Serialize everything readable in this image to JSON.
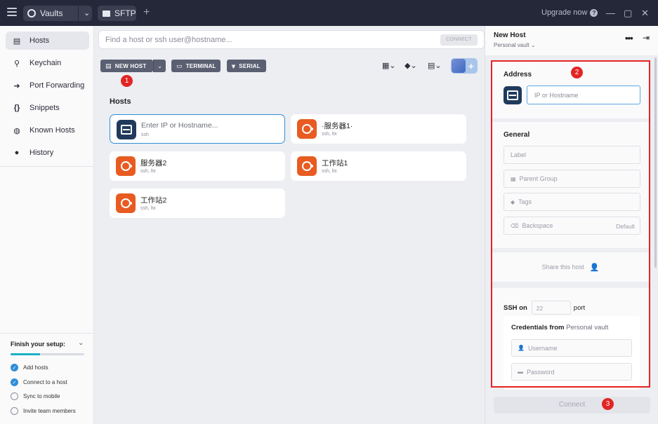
{
  "titlebar": {
    "vault_label": "Vaults",
    "sftp_label": "SFTP",
    "upgrade_label": "Upgrade now"
  },
  "sidebar": {
    "items": [
      {
        "label": "Hosts",
        "icon": "hosts-icon"
      },
      {
        "label": "Keychain",
        "icon": "key-icon"
      },
      {
        "label": "Port Forwarding",
        "icon": "forward-icon"
      },
      {
        "label": "Snippets",
        "icon": "braces-icon"
      },
      {
        "label": "Known Hosts",
        "icon": "known-hosts-icon"
      },
      {
        "label": "History",
        "icon": "history-icon"
      }
    ],
    "setup": {
      "title": "Finish your setup:",
      "progress": 0.4,
      "items": [
        {
          "label": "Add hosts",
          "done": true
        },
        {
          "label": "Connect to a host",
          "done": true
        },
        {
          "label": "Sync to mobile",
          "done": false
        },
        {
          "label": "Invite team members",
          "done": false
        }
      ]
    }
  },
  "main": {
    "search_placeholder": "Find a host or ssh user@hostname...",
    "connect_label": "CONNECT",
    "toolbar": {
      "new_host": "NEW HOST",
      "terminal": "TERMINAL",
      "serial": "SERIAL"
    },
    "hosts_heading": "Hosts",
    "hosts": [
      {
        "name": "Enter IP or Hostname...",
        "sub": "ssh",
        "type": "server"
      },
      {
        "name": "·服务器1·",
        "sub": "ssh, ltx",
        "type": "ubuntu"
      },
      {
        "name": "服务器2",
        "sub": "ssh, ltx",
        "type": "ubuntu"
      },
      {
        "name": "工作站1",
        "sub": "ssh, ltx",
        "type": "ubuntu"
      },
      {
        "name": "工作站2",
        "sub": "ssh, ltx",
        "type": "ubuntu"
      }
    ]
  },
  "panel": {
    "title": "New Host",
    "vault": "Personal vault",
    "address": {
      "title": "Address",
      "placeholder": "IP or Hostname"
    },
    "general": {
      "title": "General",
      "label_ph": "Label",
      "parent_group_ph": "Parent Group",
      "tags_ph": "Tags",
      "backspace_ph": "Backspace",
      "backspace_value": "Default"
    },
    "share_label": "Share this host",
    "ssh": {
      "ssh_on": "SSH on",
      "port": "22",
      "port_label": "port",
      "cred_title": "Credentials from",
      "cred_vault": "Personal vault",
      "username_ph": "Username",
      "password_ph": "Password"
    },
    "connect_label": "Connect"
  },
  "badges": [
    "1",
    "2",
    "3"
  ]
}
